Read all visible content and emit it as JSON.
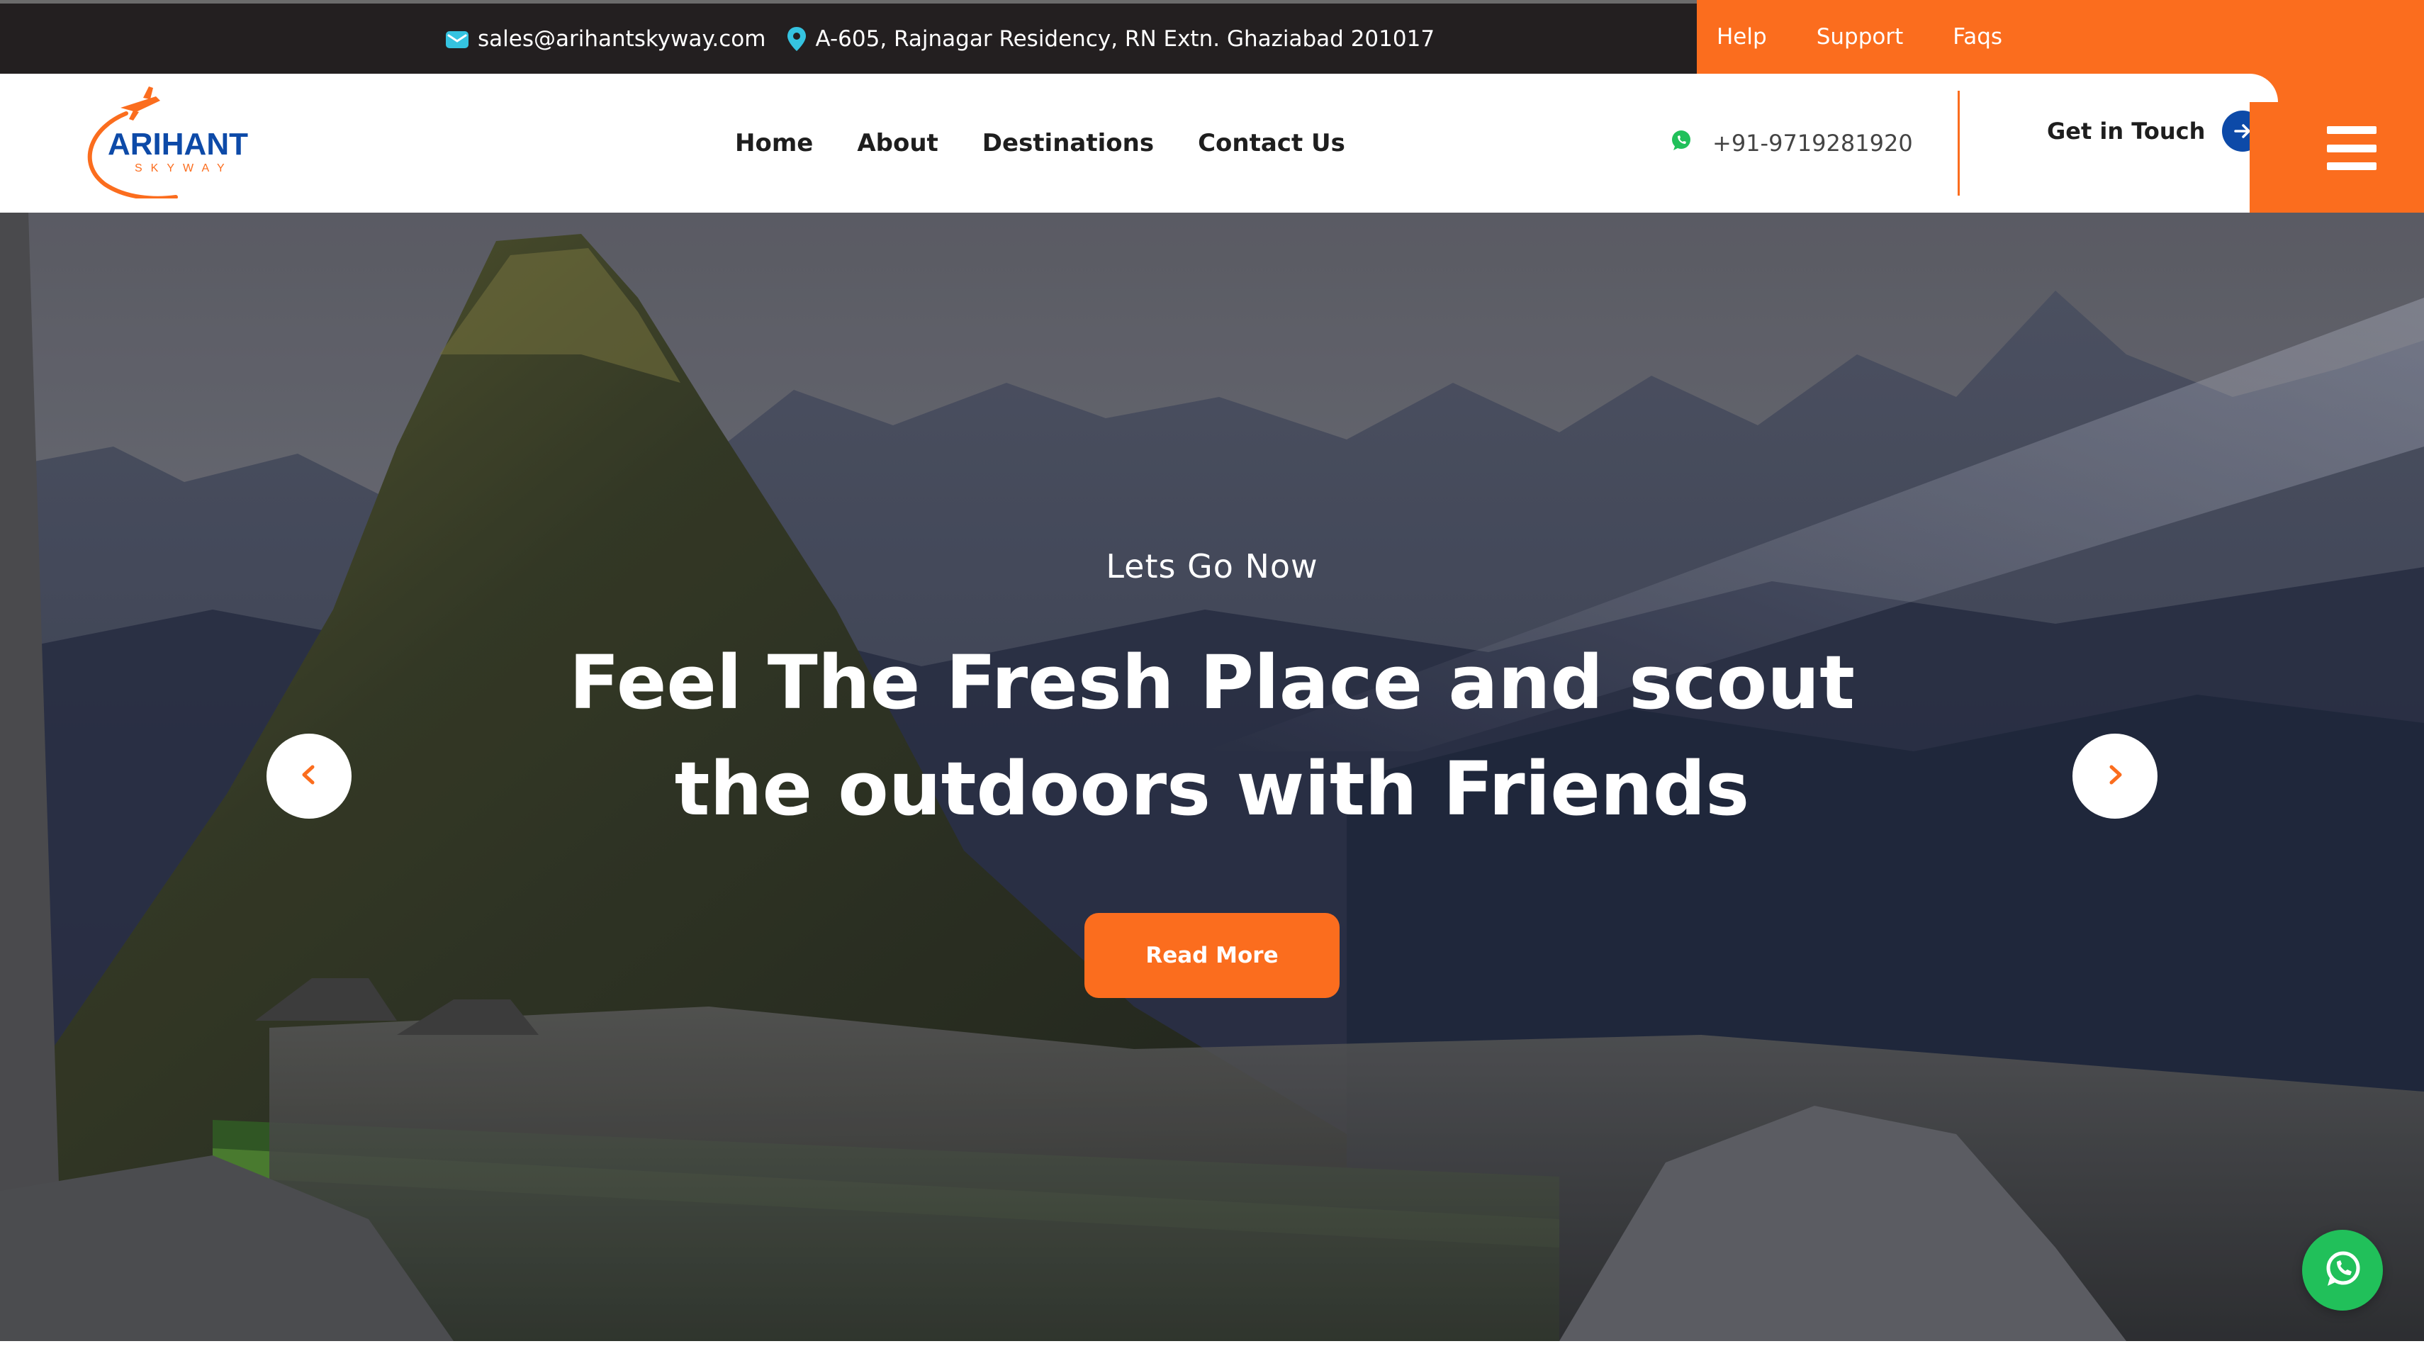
{
  "topbar": {
    "email": "sales@arihantskyway.com",
    "address": "A-605, Rajnagar Residency, RN Extn. Ghaziabad 201017",
    "links": [
      "Help",
      "Support",
      "Faqs"
    ]
  },
  "header": {
    "logo": {
      "name": "ARIHANT",
      "tagline": "SKYWAY"
    },
    "nav": [
      "Home",
      "About",
      "Destinations",
      "Contact Us"
    ],
    "phone": "+91-9719281920",
    "cta_label": "Get in Touch"
  },
  "hero": {
    "eyebrow": "Lets Go Now",
    "headline": "Feel The Fresh Place and scout the outdoors with Friends",
    "button_label": "Read More"
  },
  "icons": {
    "email": "mail-icon",
    "address": "map-pin-icon",
    "phone": "whatsapp-icon",
    "cta": "arrow-right-icon",
    "menu": "hamburger-menu-icon",
    "prev": "chevron-left-icon",
    "next": "chevron-right-icon",
    "chat": "whatsapp-icon"
  },
  "colors": {
    "accent": "#fb6d1e",
    "brand_blue": "#0d4aa8",
    "topbar": "#231f20",
    "whatsapp": "#21c05a"
  }
}
